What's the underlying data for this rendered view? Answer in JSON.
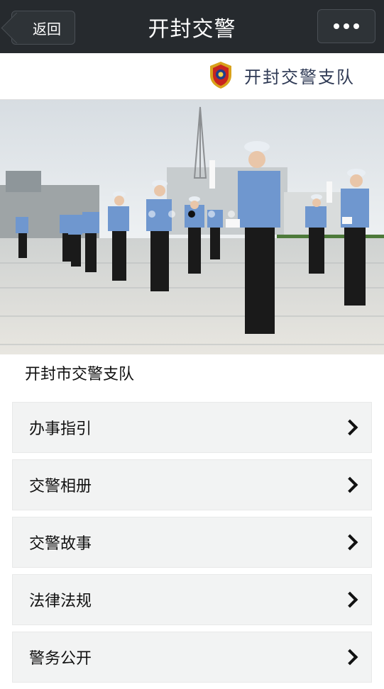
{
  "topbar": {
    "back_label": "返回",
    "title": "开封交警"
  },
  "brand": {
    "name": "开封交警支队"
  },
  "banner": {
    "slide_count": 5,
    "active_slide": 3
  },
  "section": {
    "title": "开封市交警支队"
  },
  "menu": {
    "items": [
      {
        "label": "办事指引"
      },
      {
        "label": "交警相册"
      },
      {
        "label": "交警故事"
      },
      {
        "label": "法律法规"
      },
      {
        "label": "警务公开"
      }
    ]
  },
  "colors": {
    "topbar_bg": "#262a2e",
    "menu_bg": "#f2f3f3",
    "brand_text": "#2f3a55"
  }
}
